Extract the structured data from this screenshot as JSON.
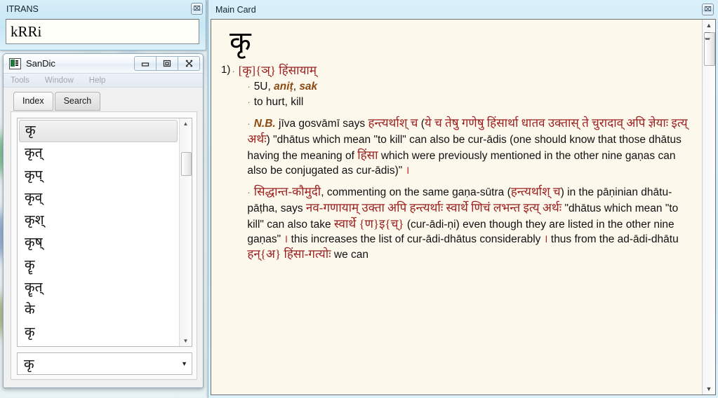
{
  "itrans": {
    "title": "ITRANS",
    "close_glyph": "⌧",
    "input_value": "kRRi",
    "input_placeholder": ""
  },
  "sandic": {
    "title": "SanDic",
    "minimize_glyph": "–",
    "maximize_glyph": "□",
    "close_glyph": "✕",
    "menu": [
      "Tools",
      "Window",
      "Help"
    ],
    "tabs": [
      {
        "label": "Index",
        "active": true
      },
      {
        "label": "Search",
        "active": false
      }
    ],
    "list": {
      "selected_index": 0,
      "items": [
        "कृ",
        "कृत्",
        "कृप्",
        "कृव्",
        "कृश्",
        "कृष्",
        "कॄ",
        "कॄत्",
        "के",
        "कृ"
      ]
    },
    "combo": {
      "value": "कृ",
      "chevron": "▼"
    },
    "scroll": {
      "up_glyph": "▲",
      "down_glyph": "▼"
    }
  },
  "maincard": {
    "title": "Main Card",
    "close_glyph": "⌧",
    "headword": "कृ",
    "scroll": {
      "up_glyph": "▲",
      "down_glyph": "▼"
    },
    "entry": {
      "number": "1)",
      "bullet": "·",
      "headline_dev": "[कृ]{ञ्} हिंसायाम्",
      "grammar_prefix": "5U, ",
      "grammar_anit": "aniṭ",
      "grammar_sep": ", ",
      "grammar_sak": "sak",
      "gloss": "to hurt, kill",
      "nb_label": "N.B.",
      "nb_p1_a": " jīva gosvāmī says ",
      "nb_p1_dev1": "हन्त्यर्थाश् च",
      "nb_p1_b": " (",
      "nb_p1_dev2": "ये च तेषु गणेषु हिंसार्था धातव उक्तास् ते चुरादाव् अपि ज्ञेयाः इत्य् अर्थः",
      "nb_p1_c": ") \"dhātus which mean \"to kill\" can also be cur-ādis (one should know that those dhātus having the meaning of ",
      "nb_p1_dev3": "हिंसा",
      "nb_p1_d": " which were previously mentioned in the other nine gaṇas can also be conjugated as cur-ādis)\" ",
      "nb_p1_danda": "।",
      "p2_dev1": "सिद्धान्त-कौमुदी",
      "p2_a": ", commenting on the same gaṇa-sūtra (",
      "p2_dev2": "हन्त्यर्थाश् च",
      "p2_b": ") in the pāṇinian dhātu-pāṭha, says ",
      "p2_dev3": "नव-गणायाम् उक्ता अपि हन्त्यर्थाः स्वार्थे णिचं लभन्त इत्य् अर्थः",
      "p2_c": " \"dhātus which mean \"to kill\" can also take ",
      "p2_dev4": "स्वार्थे {ण}इ{च्}",
      "p2_d": " (cur-ādi-ṇi) even though they are listed in the other nine gaṇas\" ",
      "p2_danda1": "।",
      "p2_e": " this increases the list of cur-ādi-dhātus considerably ",
      "p2_danda2": "।",
      "p2_f": " thus from the ad-ādi-dhātu ",
      "p2_dev5": "हन्{अ}",
      "p2_g": " ",
      "p2_dev6": "हिंसा-गत्योः",
      "p2_h": " we can"
    }
  }
}
